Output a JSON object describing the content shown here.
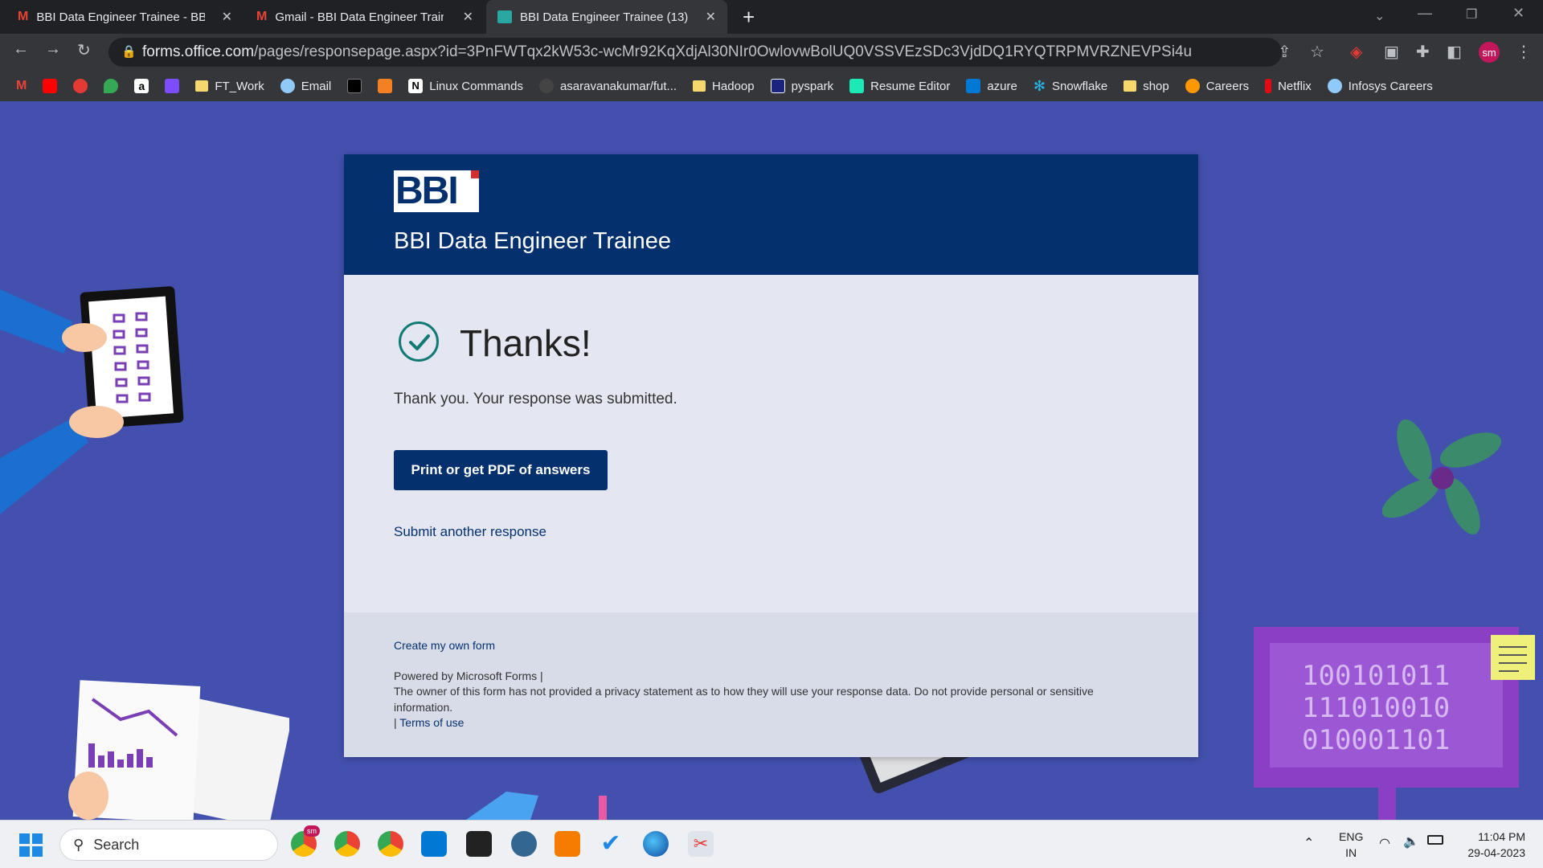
{
  "browser": {
    "tabs": [
      {
        "title": "BBI Data Engineer Trainee - BBID",
        "icon": "gmail-icon"
      },
      {
        "title": "Gmail - BBI Data Engineer Traine",
        "icon": "gmail-icon"
      },
      {
        "title": "BBI Data Engineer Trainee (13)",
        "icon": "forms-icon",
        "active": true
      }
    ],
    "new_tab": "+",
    "url_domain": "forms.office.com",
    "url_path": "/pages/responsepage.aspx?id=3PnFWTqx2kW53c-wcMr92KqXdjAl30NIr0OwlovwBolUQ0VSSVEzSDc3VjdDQ1RYQTRPMVRZNEVPSi4u",
    "profile_initials": "sm"
  },
  "bookmarks": [
    {
      "label": "FT_Work"
    },
    {
      "label": "Email"
    },
    {
      "label": "Linux Commands"
    },
    {
      "label": "asaravanakumar/fut..."
    },
    {
      "label": "Hadoop"
    },
    {
      "label": "pyspark"
    },
    {
      "label": "Resume Editor"
    },
    {
      "label": "azure"
    },
    {
      "label": "Snowflake"
    },
    {
      "label": "shop"
    },
    {
      "label": "Careers"
    },
    {
      "label": "Netflix"
    },
    {
      "label": "Infosys Careers"
    }
  ],
  "form": {
    "logo_text": "BBI",
    "title": "BBI Data Engineer Trainee",
    "heading": "Thanks!",
    "message": "Thank you. Your response was submitted.",
    "print_button": "Print or get PDF of answers",
    "submit_another": "Submit another response",
    "create_link": "Create my own form",
    "powered_by": "Powered by Microsoft Forms |",
    "privacy_text": "The owner of this form has not provided a privacy statement as to how they will use your response data. Do not provide personal or sensitive information.",
    "terms_prefix": "| ",
    "terms_link": "Terms of use"
  },
  "illustration": {
    "binary_lines": [
      "100101011",
      "111010010",
      "010001101"
    ]
  },
  "taskbar": {
    "search_placeholder": "Search",
    "language": "ENG",
    "region": "IN",
    "time": "11:04 PM",
    "date": "29-04-2023",
    "chrome_badge": "sm"
  },
  "colors": {
    "page_background": "#4350ae",
    "form_header": "#04316d",
    "card_body": "#e4e7f1",
    "check_accent": "#117a74"
  }
}
